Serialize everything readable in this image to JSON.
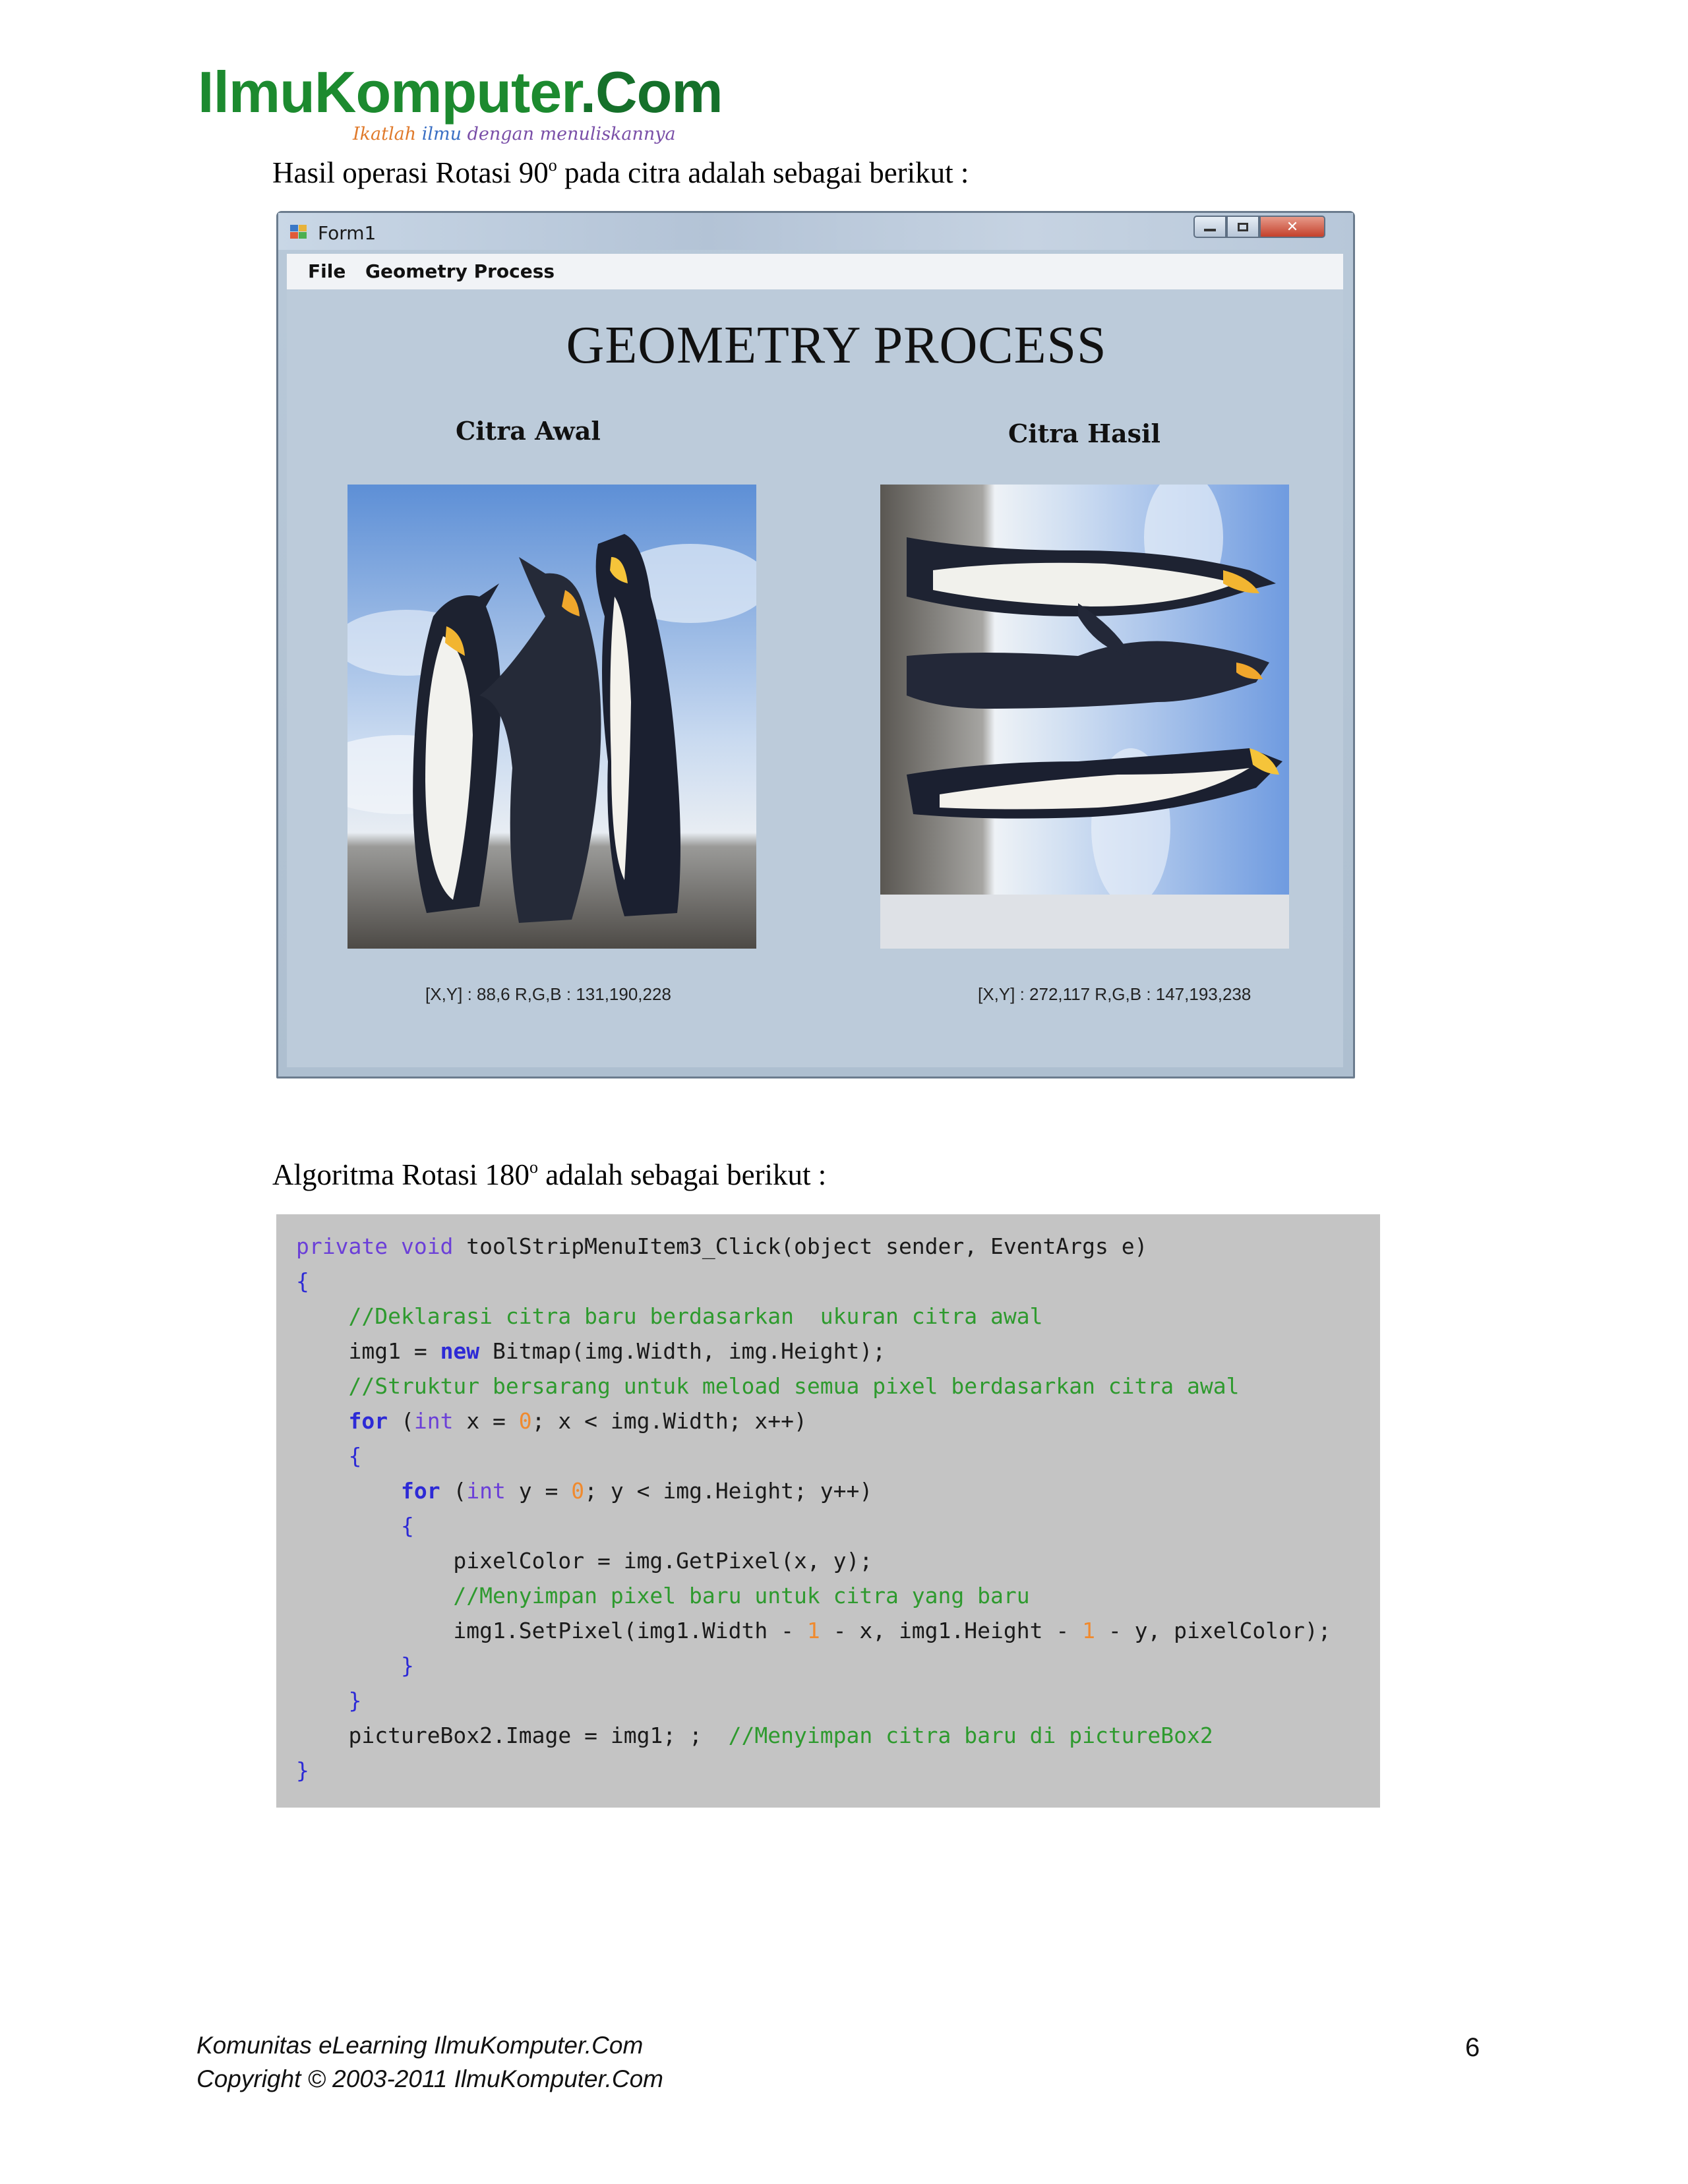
{
  "header": {
    "logo_main": "IlmuKomputer",
    "logo_dot": ".Com",
    "tagline_w1": "Ikatlah",
    "tagline_w2": "ilmu",
    "tagline_rest": "dengan menuliskannya"
  },
  "para1": {
    "text": "Hasil operasi Rotasi 90",
    "sup": "o",
    "tail": "  pada citra adalah sebagai berikut :"
  },
  "window": {
    "title": "Form1",
    "controls": {
      "close": "✕"
    },
    "menu": [
      "File",
      "Geometry Process"
    ],
    "heading": "GEOMETRY  PROCESS",
    "caption_left": "Citra Awal",
    "caption_right": "Citra Hasil",
    "coord_left": "[X,Y] : 88,6  R,G,B : 131,190,228",
    "coord_right": "[X,Y] : 272,117  R,G,B : 147,193,238",
    "colors": {
      "client_bg": "#bccbda",
      "title_bar": "#c1d0e0"
    }
  },
  "para2": {
    "text": "Algoritma Rotasi  180",
    "sup": "o",
    "tail": " adalah sebagai berikut :"
  },
  "code": {
    "colors": {
      "keyword": "#6b3fd8",
      "type": "#2d2ad6",
      "comment": "#2e9a2e",
      "number": "#f08a2e",
      "background": "#c4c4c4"
    },
    "l1": {
      "kw1": "private",
      "kw2": "void",
      "rest": " toolStripMenuItem3_Click(object sender, EventArgs e)"
    },
    "l2": "{",
    "l3": "//Deklarasi citra baru berdasarkan  ukuran citra awal",
    "l4": {
      "a": "img1 = ",
      "kb": "new",
      "b": " Bitmap(img.Width, img.Height);"
    },
    "l5": "//Struktur bersarang untuk meload semua pixel berdasarkan citra awal",
    "l6": {
      "kb": "for",
      "a": " (",
      "kw": "int",
      "b": " x = ",
      "n": "0",
      "c": "; x < img.Width; x++)"
    },
    "l7": "{",
    "l8": {
      "kb": "for",
      "a": " (",
      "kw": "int",
      "b": " y = ",
      "n": "0",
      "c": "; y < img.Height; y++)"
    },
    "l9": "{",
    "l10": "pixelColor = img.GetPixel(x, y);",
    "l11": "//Menyimpan pixel baru untuk citra yang baru",
    "l12": {
      "a": "img1.SetPixel(img1.Width - ",
      "n1": "1",
      "b": " - x, img1.Height - ",
      "n2": "1",
      "c": " - y, pixelColor);"
    },
    "l13": "}",
    "l14": "}",
    "l15": {
      "a": "pictureBox2.Image = img1; ;  ",
      "cm": "//Menyimpan citra baru di pictureBox2"
    },
    "l16": "}"
  },
  "footer": {
    "line1": "Komunitas eLearning IlmuKomputer.Com",
    "line2": "Copyright © 2003-2011  IlmuKomputer.Com",
    "page_number": "6"
  }
}
